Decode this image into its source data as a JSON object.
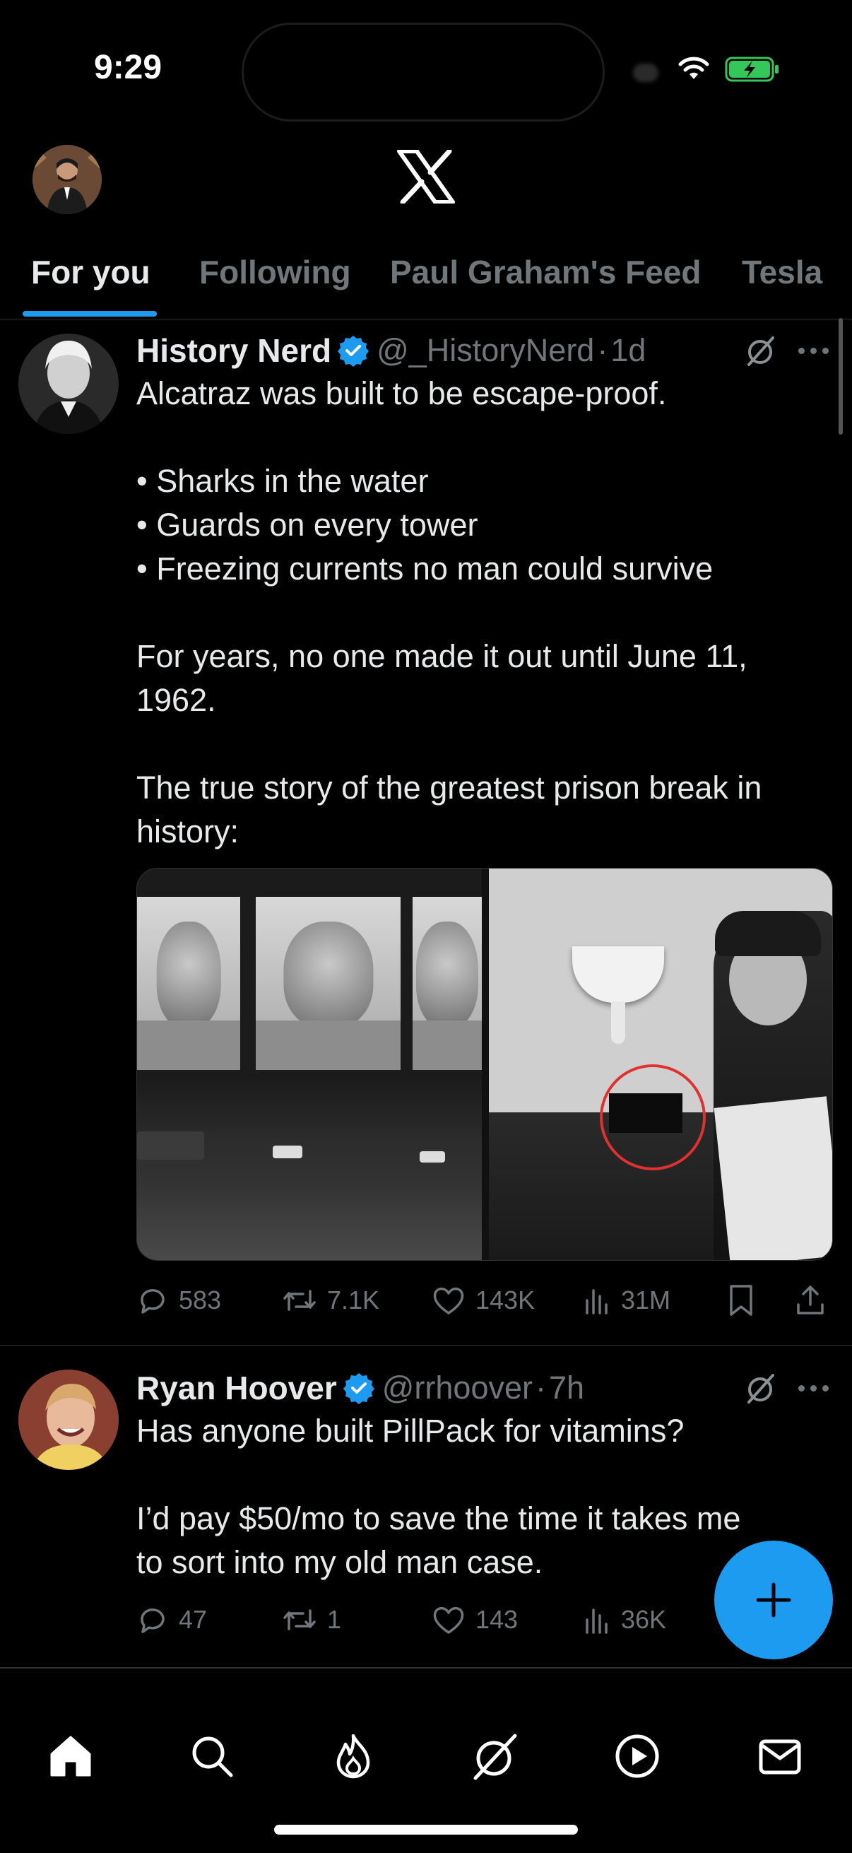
{
  "status_bar": {
    "time": "9:29"
  },
  "tabs": [
    {
      "label": "For you",
      "active": true
    },
    {
      "label": "Following",
      "active": false
    },
    {
      "label": "Paul Graham's Feed",
      "active": false
    },
    {
      "label": "Tesla",
      "active": false
    }
  ],
  "tweets": [
    {
      "name": "History Nerd",
      "verified": true,
      "handle": "@_HistoryNerd",
      "dot": "·",
      "time": "1d",
      "text": [
        "Alcatraz was built to be escape-proof.",
        "",
        "• Sharks in the water",
        "• Guards on every tower",
        "• Freezing currents no man could survive",
        "",
        "For years, no one made it out until June 11,",
        "1962.",
        "",
        "The true story of the greatest prison break in",
        "history:"
      ],
      "stats": {
        "replies": "583",
        "reposts": "7.1K",
        "likes": "143K",
        "views": "31M"
      }
    },
    {
      "name": "Ryan Hoover",
      "verified": true,
      "handle": "@rrhoover",
      "dot": "·",
      "time": "7h",
      "text": [
        "Has anyone built PillPack for vitamins?",
        "",
        "I’d pay $50/mo to save the time it takes me",
        "to sort into my old man case."
      ],
      "stats": {
        "replies": "47",
        "reposts": "1",
        "likes": "143",
        "views": "36K"
      }
    }
  ],
  "colors": {
    "accent": "#1d9bf0",
    "muted": "#71767b",
    "text": "#e7e9ea",
    "background": "#000000"
  },
  "nav_icons": [
    "home-icon",
    "search-icon",
    "flame-icon",
    "grok-icon",
    "play-icon",
    "mail-icon"
  ]
}
